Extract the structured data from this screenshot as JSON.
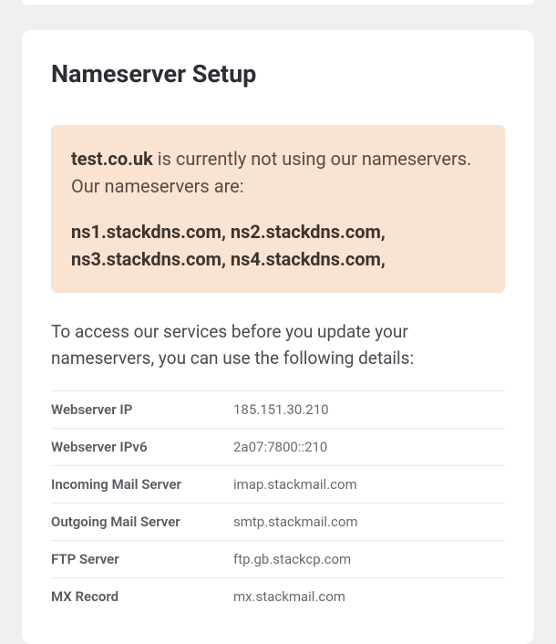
{
  "title": "Nameserver Setup",
  "alert": {
    "domain": "test.co.uk",
    "message_suffix": " is currently not using our nameservers. Our nameservers are:",
    "nameservers": "ns1.stackdns.com, ns2.stackdns.com, ns3.stackdns.com, ns4.stackdns.com,"
  },
  "description": "To access our services before you update your nameservers, you can use the following details:",
  "details": [
    {
      "label": "Webserver IP",
      "value": "185.151.30.210"
    },
    {
      "label": "Webserver IPv6",
      "value": "2a07:7800::210"
    },
    {
      "label": "Incoming Mail Server",
      "value": "imap.stackmail.com"
    },
    {
      "label": "Outgoing Mail Server",
      "value": "smtp.stackmail.com"
    },
    {
      "label": "FTP Server",
      "value": "ftp.gb.stackcp.com"
    },
    {
      "label": "MX Record",
      "value": "mx.stackmail.com"
    }
  ]
}
